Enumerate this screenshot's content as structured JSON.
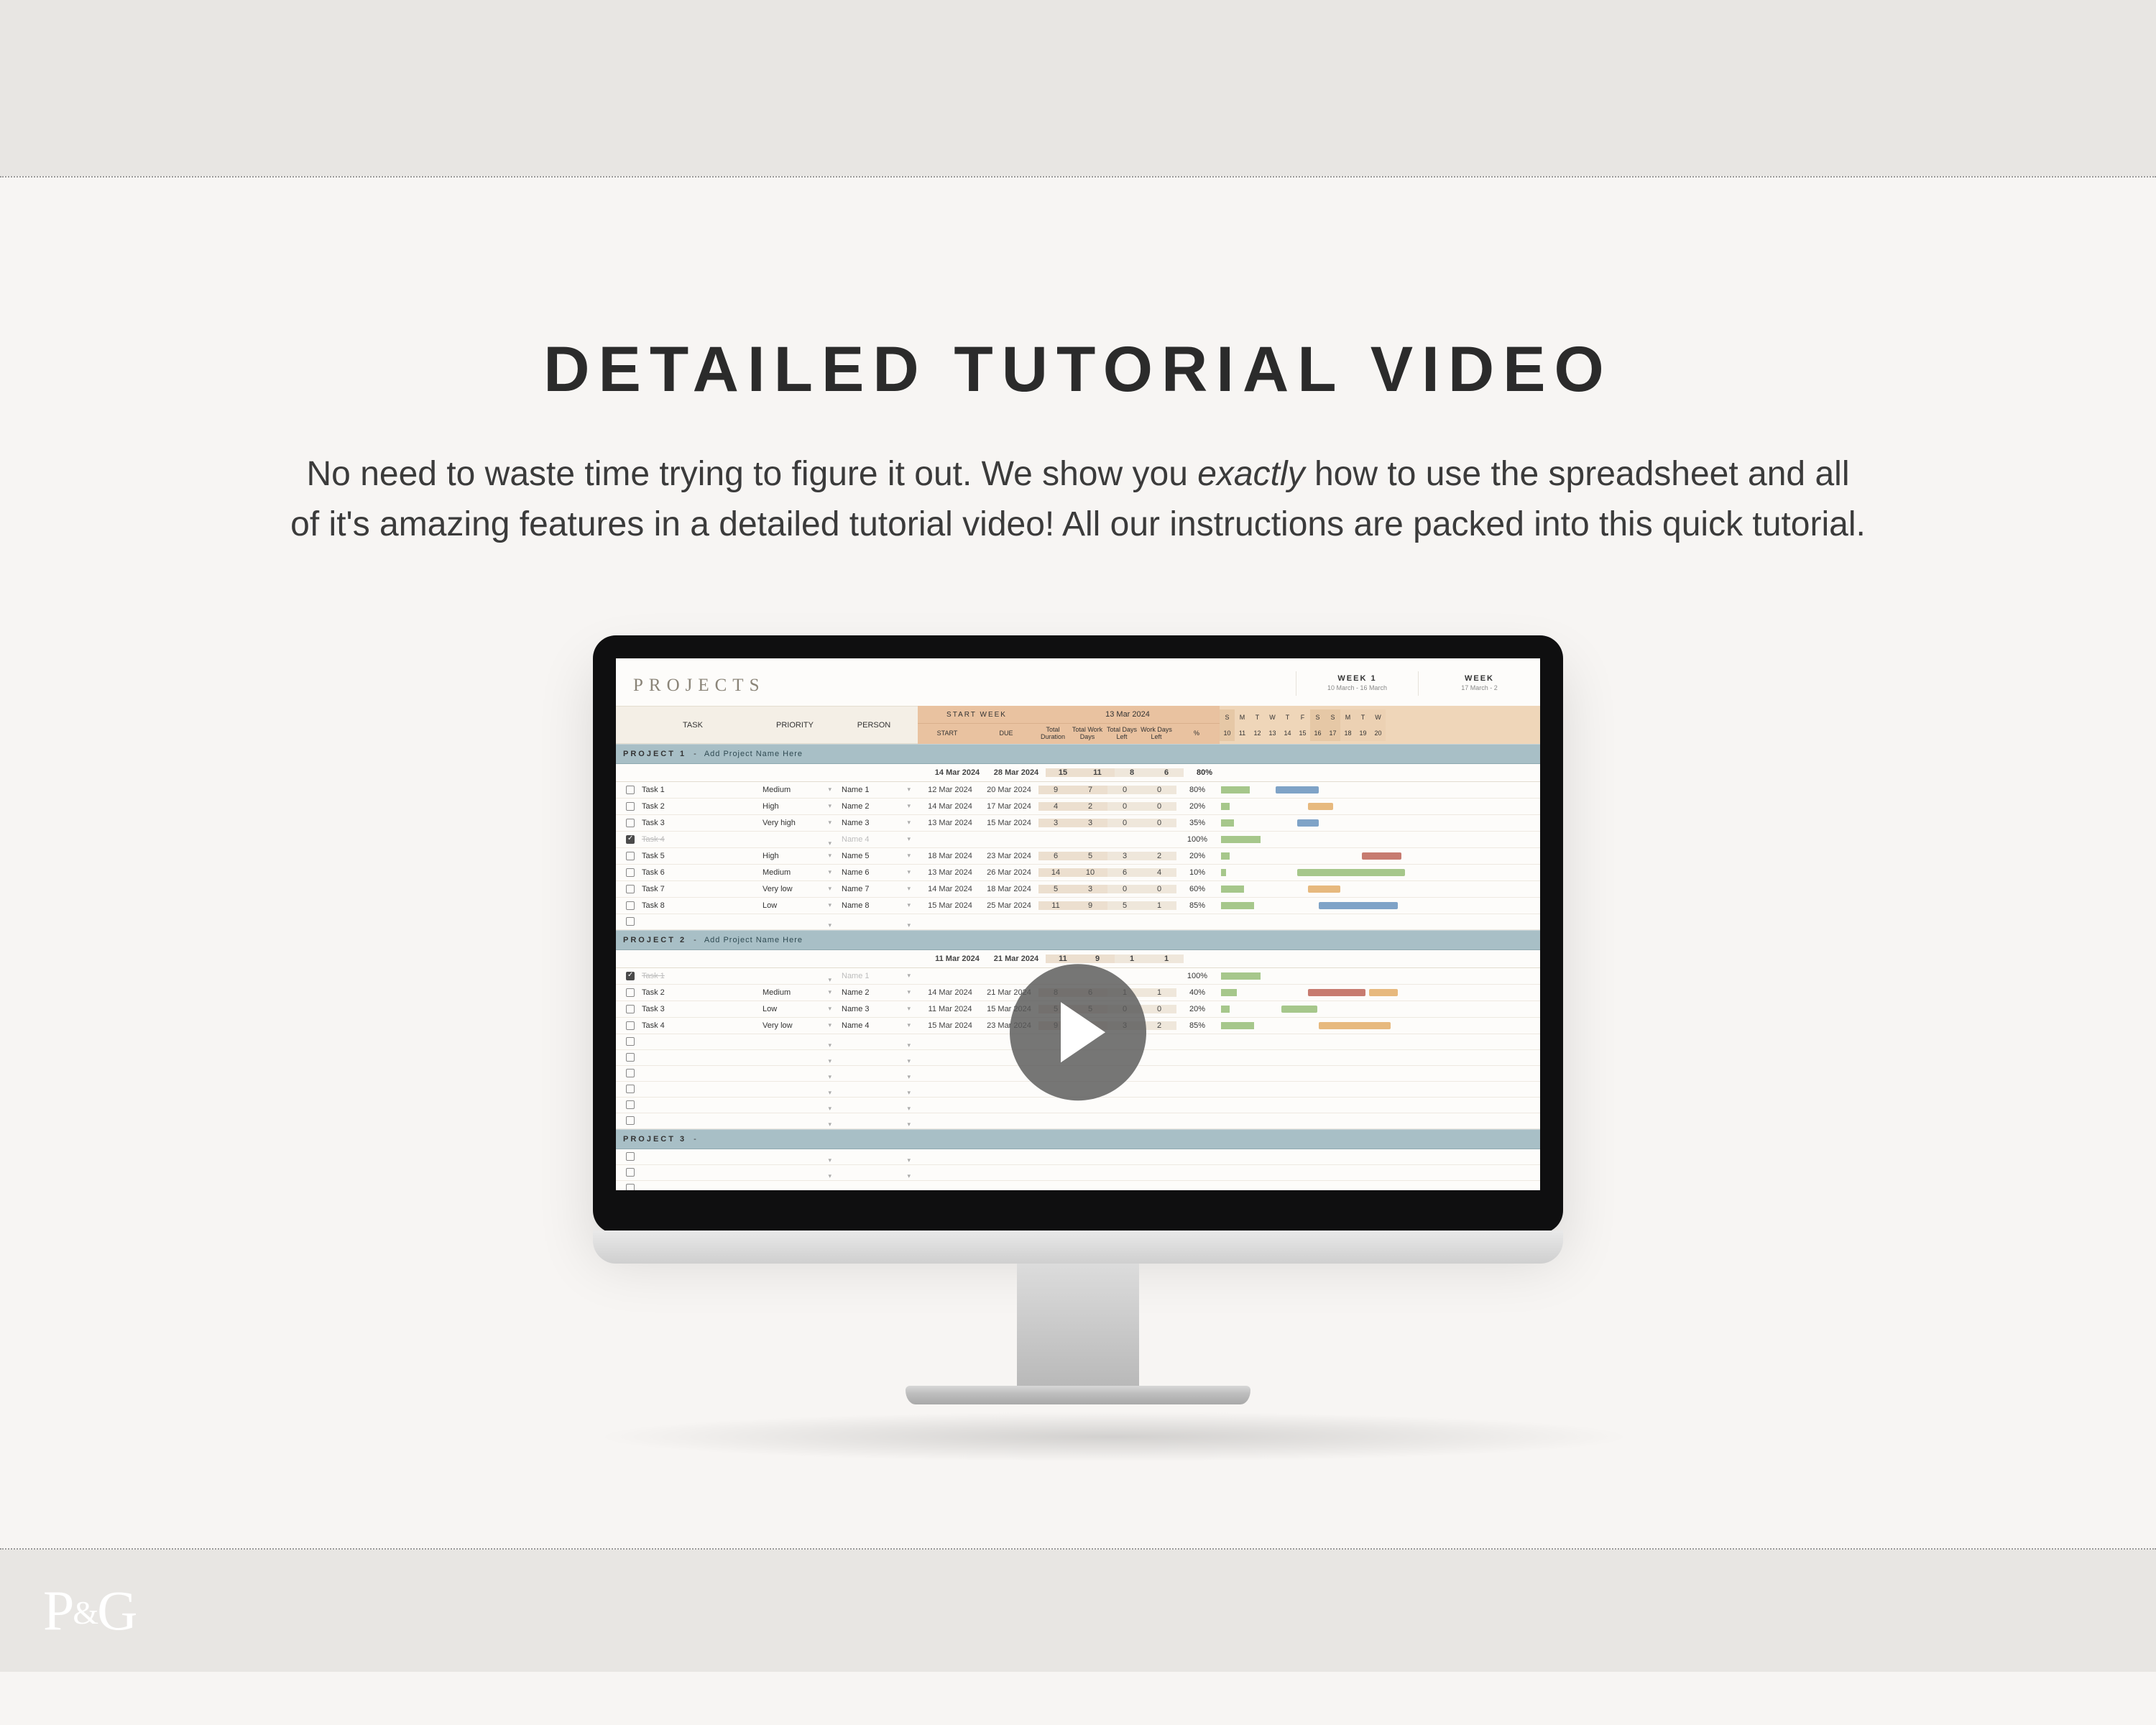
{
  "heading": "DETAILED TUTORIAL VIDEO",
  "subheading_a": "No need to waste time trying to figure it out. We show you ",
  "subheading_em": "exactly",
  "subheading_b": " how to use the spreadsheet and all of it's amazing features in a detailed tutorial video! All our instructions are packed into this quick tutorial.",
  "logo": "P&G",
  "spreadsheet": {
    "title": "PROJECTS",
    "weeks": [
      {
        "label": "WEEK 1",
        "range": "10 March - 16 March"
      },
      {
        "label": "WEEK",
        "range": "17 March - 2"
      }
    ],
    "start_week_label": "START WEEK",
    "start_week_value": "13 Mar 2024",
    "day_letters": [
      "S",
      "M",
      "T",
      "W",
      "T",
      "F",
      "S",
      "S",
      "M",
      "T",
      "W"
    ],
    "day_nums": [
      "10",
      "11",
      "12",
      "13",
      "14",
      "15",
      "16",
      "17",
      "18",
      "19",
      "20"
    ],
    "left_headers": {
      "task": "TASK",
      "priority": "PRIORITY",
      "person": "PERSON"
    },
    "mid_headers": {
      "start": "START",
      "due": "DUE",
      "dur": "Total Duration",
      "wd": "Total Work Days",
      "dl": "Total Days Left",
      "wdl": "Work Days Left",
      "pct": "%"
    },
    "projects": [
      {
        "band_name": "PROJECT 1",
        "band_sep": "-",
        "band_hint": "Add Project Name Here",
        "summary": {
          "start": "14 Mar 2024",
          "due": "28 Mar 2024",
          "dur": "15",
          "wd": "11",
          "dl": "8",
          "wdl": "6",
          "pct": "80%"
        },
        "tasks": [
          {
            "done": false,
            "name": "Task 1",
            "pri": "Medium",
            "per": "Name 1",
            "start": "12 Mar 2024",
            "due": "20 Mar 2024",
            "dur": "9",
            "wd": "7",
            "dl": "0",
            "wdl": "0",
            "pct": "80%",
            "bar": 40,
            "g": [
              {
                "l": 10,
                "w": 60,
                "c": "#7fa3c7"
              }
            ]
          },
          {
            "done": false,
            "name": "Task 2",
            "pri": "High",
            "per": "Name 2",
            "start": "14 Mar 2024",
            "due": "17 Mar 2024",
            "dur": "4",
            "wd": "2",
            "dl": "0",
            "wdl": "0",
            "pct": "20%",
            "bar": 12,
            "g": [
              {
                "l": 55,
                "w": 35,
                "c": "#e7b97e"
              }
            ]
          },
          {
            "done": false,
            "name": "Task 3",
            "pri": "Very high",
            "per": "Name 3",
            "start": "13 Mar 2024",
            "due": "15 Mar 2024",
            "dur": "3",
            "wd": "3",
            "dl": "0",
            "wdl": "0",
            "pct": "35%",
            "bar": 18,
            "g": [
              {
                "l": 40,
                "w": 30,
                "c": "#7fa3c7"
              }
            ]
          },
          {
            "done": true,
            "name": "Task 4",
            "pri": "",
            "per": "Name 4",
            "start": "",
            "due": "",
            "dur": "",
            "wd": "",
            "dl": "",
            "wdl": "",
            "pct": "100%",
            "bar": 55,
            "g": []
          },
          {
            "done": false,
            "name": "Task 5",
            "pri": "High",
            "per": "Name 5",
            "start": "18 Mar 2024",
            "due": "23 Mar 2024",
            "dur": "6",
            "wd": "5",
            "dl": "3",
            "wdl": "2",
            "pct": "20%",
            "bar": 12,
            "g": [
              {
                "l": 130,
                "w": 55,
                "c": "#c77b70"
              }
            ]
          },
          {
            "done": false,
            "name": "Task 6",
            "pri": "Medium",
            "per": "Name 6",
            "start": "13 Mar 2024",
            "due": "26 Mar 2024",
            "dur": "14",
            "wd": "10",
            "dl": "6",
            "wdl": "4",
            "pct": "10%",
            "bar": 7,
            "g": [
              {
                "l": 40,
                "w": 150,
                "c": "#a6c78b"
              }
            ]
          },
          {
            "done": false,
            "name": "Task 7",
            "pri": "Very low",
            "per": "Name 7",
            "start": "14 Mar 2024",
            "due": "18 Mar 2024",
            "dur": "5",
            "wd": "3",
            "dl": "0",
            "wdl": "0",
            "pct": "60%",
            "bar": 32,
            "g": [
              {
                "l": 55,
                "w": 45,
                "c": "#e7b97e"
              }
            ]
          },
          {
            "done": false,
            "name": "Task 8",
            "pri": "Low",
            "per": "Name 8",
            "start": "15 Mar 2024",
            "due": "25 Mar 2024",
            "dur": "11",
            "wd": "9",
            "dl": "5",
            "wdl": "1",
            "pct": "85%",
            "bar": 46,
            "g": [
              {
                "l": 70,
                "w": 110,
                "c": "#7fa3c7"
              }
            ]
          }
        ],
        "empty_rows": 1
      },
      {
        "band_name": "PROJECT 2",
        "band_sep": "-",
        "band_hint": "Add Project Name Here",
        "summary": {
          "start": "11 Mar 2024",
          "due": "21 Mar 2024",
          "dur": "11",
          "wd": "9",
          "dl": "1",
          "wdl": "1",
          "pct": ""
        },
        "tasks": [
          {
            "done": true,
            "name": "Task 1",
            "pri": "",
            "per": "Name 1",
            "start": "",
            "due": "",
            "dur": "",
            "wd": "",
            "dl": "",
            "wdl": "",
            "pct": "100%",
            "bar": 55,
            "g": []
          },
          {
            "done": false,
            "name": "Task 2",
            "pri": "Medium",
            "per": "Name 2",
            "start": "14 Mar 2024",
            "due": "21 Mar 2024",
            "dur": "8",
            "wd": "6",
            "dl": "1",
            "wdl": "1",
            "pct": "40%",
            "bar": 22,
            "g": [
              {
                "l": 55,
                "w": 80,
                "c": "#c77b70"
              },
              {
                "l": 140,
                "w": 40,
                "c": "#e7b97e"
              }
            ]
          },
          {
            "done": false,
            "name": "Task 3",
            "pri": "Low",
            "per": "Name 3",
            "start": "11 Mar 2024",
            "due": "15 Mar 2024",
            "dur": "5",
            "wd": "5",
            "dl": "0",
            "wdl": "0",
            "pct": "20%",
            "bar": 12,
            "g": [
              {
                "l": 18,
                "w": 50,
                "c": "#a6c78b"
              }
            ]
          },
          {
            "done": false,
            "name": "Task 4",
            "pri": "Very low",
            "per": "Name 4",
            "start": "15 Mar 2024",
            "due": "23 Mar 2024",
            "dur": "9",
            "wd": "6",
            "dl": "3",
            "wdl": "2",
            "pct": "85%",
            "bar": 46,
            "g": [
              {
                "l": 70,
                "w": 100,
                "c": "#e7b97e"
              }
            ]
          }
        ],
        "empty_rows": 6
      },
      {
        "band_name": "PROJECT 3",
        "band_sep": "-",
        "band_hint": "",
        "summary": null,
        "tasks": [],
        "empty_rows": 3
      }
    ]
  }
}
